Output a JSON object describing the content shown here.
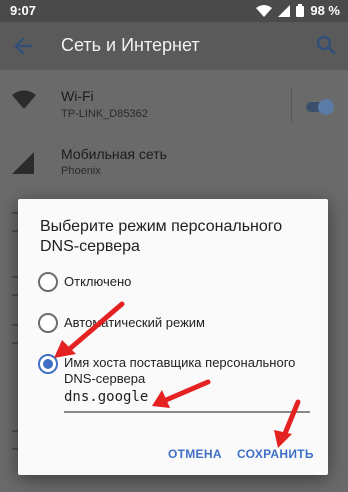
{
  "status_bar": {
    "time": "9:07",
    "battery_percent": "98 %",
    "icons": [
      "wifi-icon",
      "signal-icon",
      "battery-icon"
    ]
  },
  "app_bar": {
    "title": "Сеть и Интернет",
    "back_icon": "arrow-back-icon",
    "search_icon": "search-icon"
  },
  "settings": {
    "wifi": {
      "title": "Wi-Fi",
      "subtitle": "TP-LINK_D85362",
      "enabled": true
    },
    "mobile": {
      "title": "Мобильная сеть",
      "subtitle": "Phoenix"
    }
  },
  "dialog": {
    "title": "Выберите режим персонального DNS-сервера",
    "options": [
      {
        "label": "Отключено",
        "checked": false
      },
      {
        "label": "Автоматический режим",
        "checked": false
      },
      {
        "label": "Имя хоста поставщика персонального DNS-сервера",
        "checked": true
      }
    ],
    "hostname_value": "dns.google",
    "cancel_label": "ОТМЕНА",
    "save_label": "СОХРАНИТЬ"
  },
  "colors": {
    "accent": "#3f6fc6",
    "annotation": "#e52222",
    "scrim": "#6a6a6a"
  }
}
